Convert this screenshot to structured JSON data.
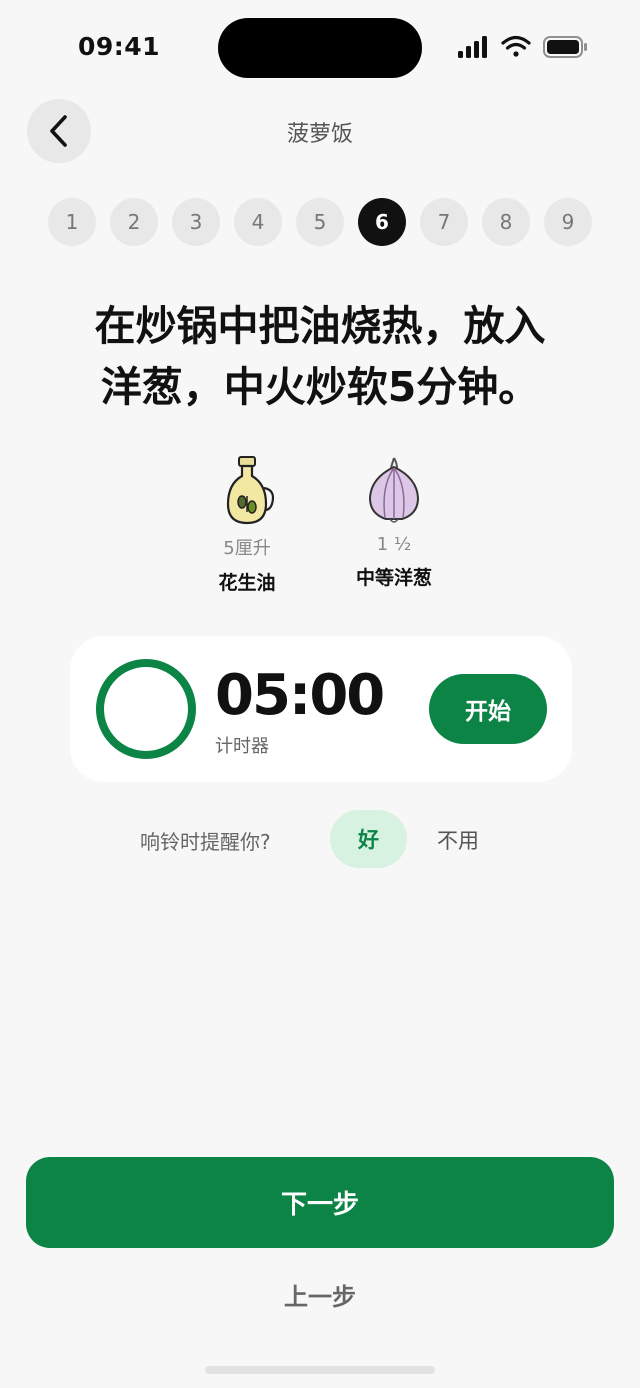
{
  "status_bar": {
    "time": "09:41",
    "icons": [
      "cellular-signal-icon",
      "wifi-icon",
      "battery-icon"
    ]
  },
  "header": {
    "title": "菠萝饭",
    "back_icon": "chevron-left-icon"
  },
  "steps": {
    "items": [
      "1",
      "2",
      "3",
      "4",
      "5",
      "6",
      "7",
      "8",
      "9"
    ],
    "current": "6"
  },
  "instruction": {
    "line1": "在炒锅中把油烧热，放入",
    "line2": "洋葱，中火炒软5分钟。"
  },
  "ingredients": [
    {
      "icon": "oil-bottle-icon",
      "quantity": "5厘升",
      "name": "花生油"
    },
    {
      "icon": "onion-icon",
      "quantity": "1 ½",
      "name": "中等洋葱"
    }
  ],
  "timer": {
    "value": "05:00",
    "label": "计时器",
    "start_label": "开始",
    "progress": 1.0
  },
  "reminder": {
    "question": "响铃时提醒你?",
    "yes_label": "好",
    "no_label": "不用"
  },
  "footer": {
    "next_label": "下一步",
    "prev_label": "上一步"
  },
  "colors": {
    "accent": "#0b8446",
    "accent_light": "#d8f2e2",
    "background": "#f7f7f7"
  }
}
